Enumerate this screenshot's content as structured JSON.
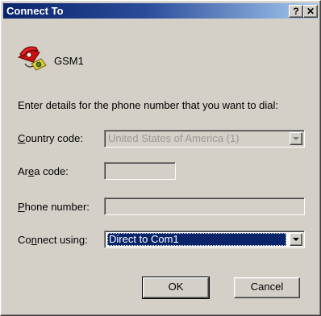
{
  "window": {
    "title": "Connect To",
    "help_glyph": "?",
    "close_glyph": "✕"
  },
  "connection": {
    "icon": "phone-icon",
    "name": "GSM1"
  },
  "instructions": "Enter details for the phone number that you want to dial:",
  "form": {
    "country_code": {
      "label_prefix": "",
      "label_key": "C",
      "label_rest": "ountry code:",
      "value": "United States of America (1)",
      "enabled": false
    },
    "area_code": {
      "label_prefix": "Ar",
      "label_key": "e",
      "label_rest": "a code:",
      "value": ""
    },
    "phone_number": {
      "label_prefix": "",
      "label_key": "P",
      "label_rest": "hone number:",
      "value": ""
    },
    "connect_using": {
      "label_prefix": "Co",
      "label_key": "n",
      "label_rest": "nect using:",
      "value": "Direct to Com1"
    }
  },
  "buttons": {
    "ok": "OK",
    "cancel": "Cancel"
  },
  "colors": {
    "title_start": "#0a246a",
    "title_end": "#a6caf0",
    "selection": "#0a246a",
    "face": "#d4d0c8"
  }
}
